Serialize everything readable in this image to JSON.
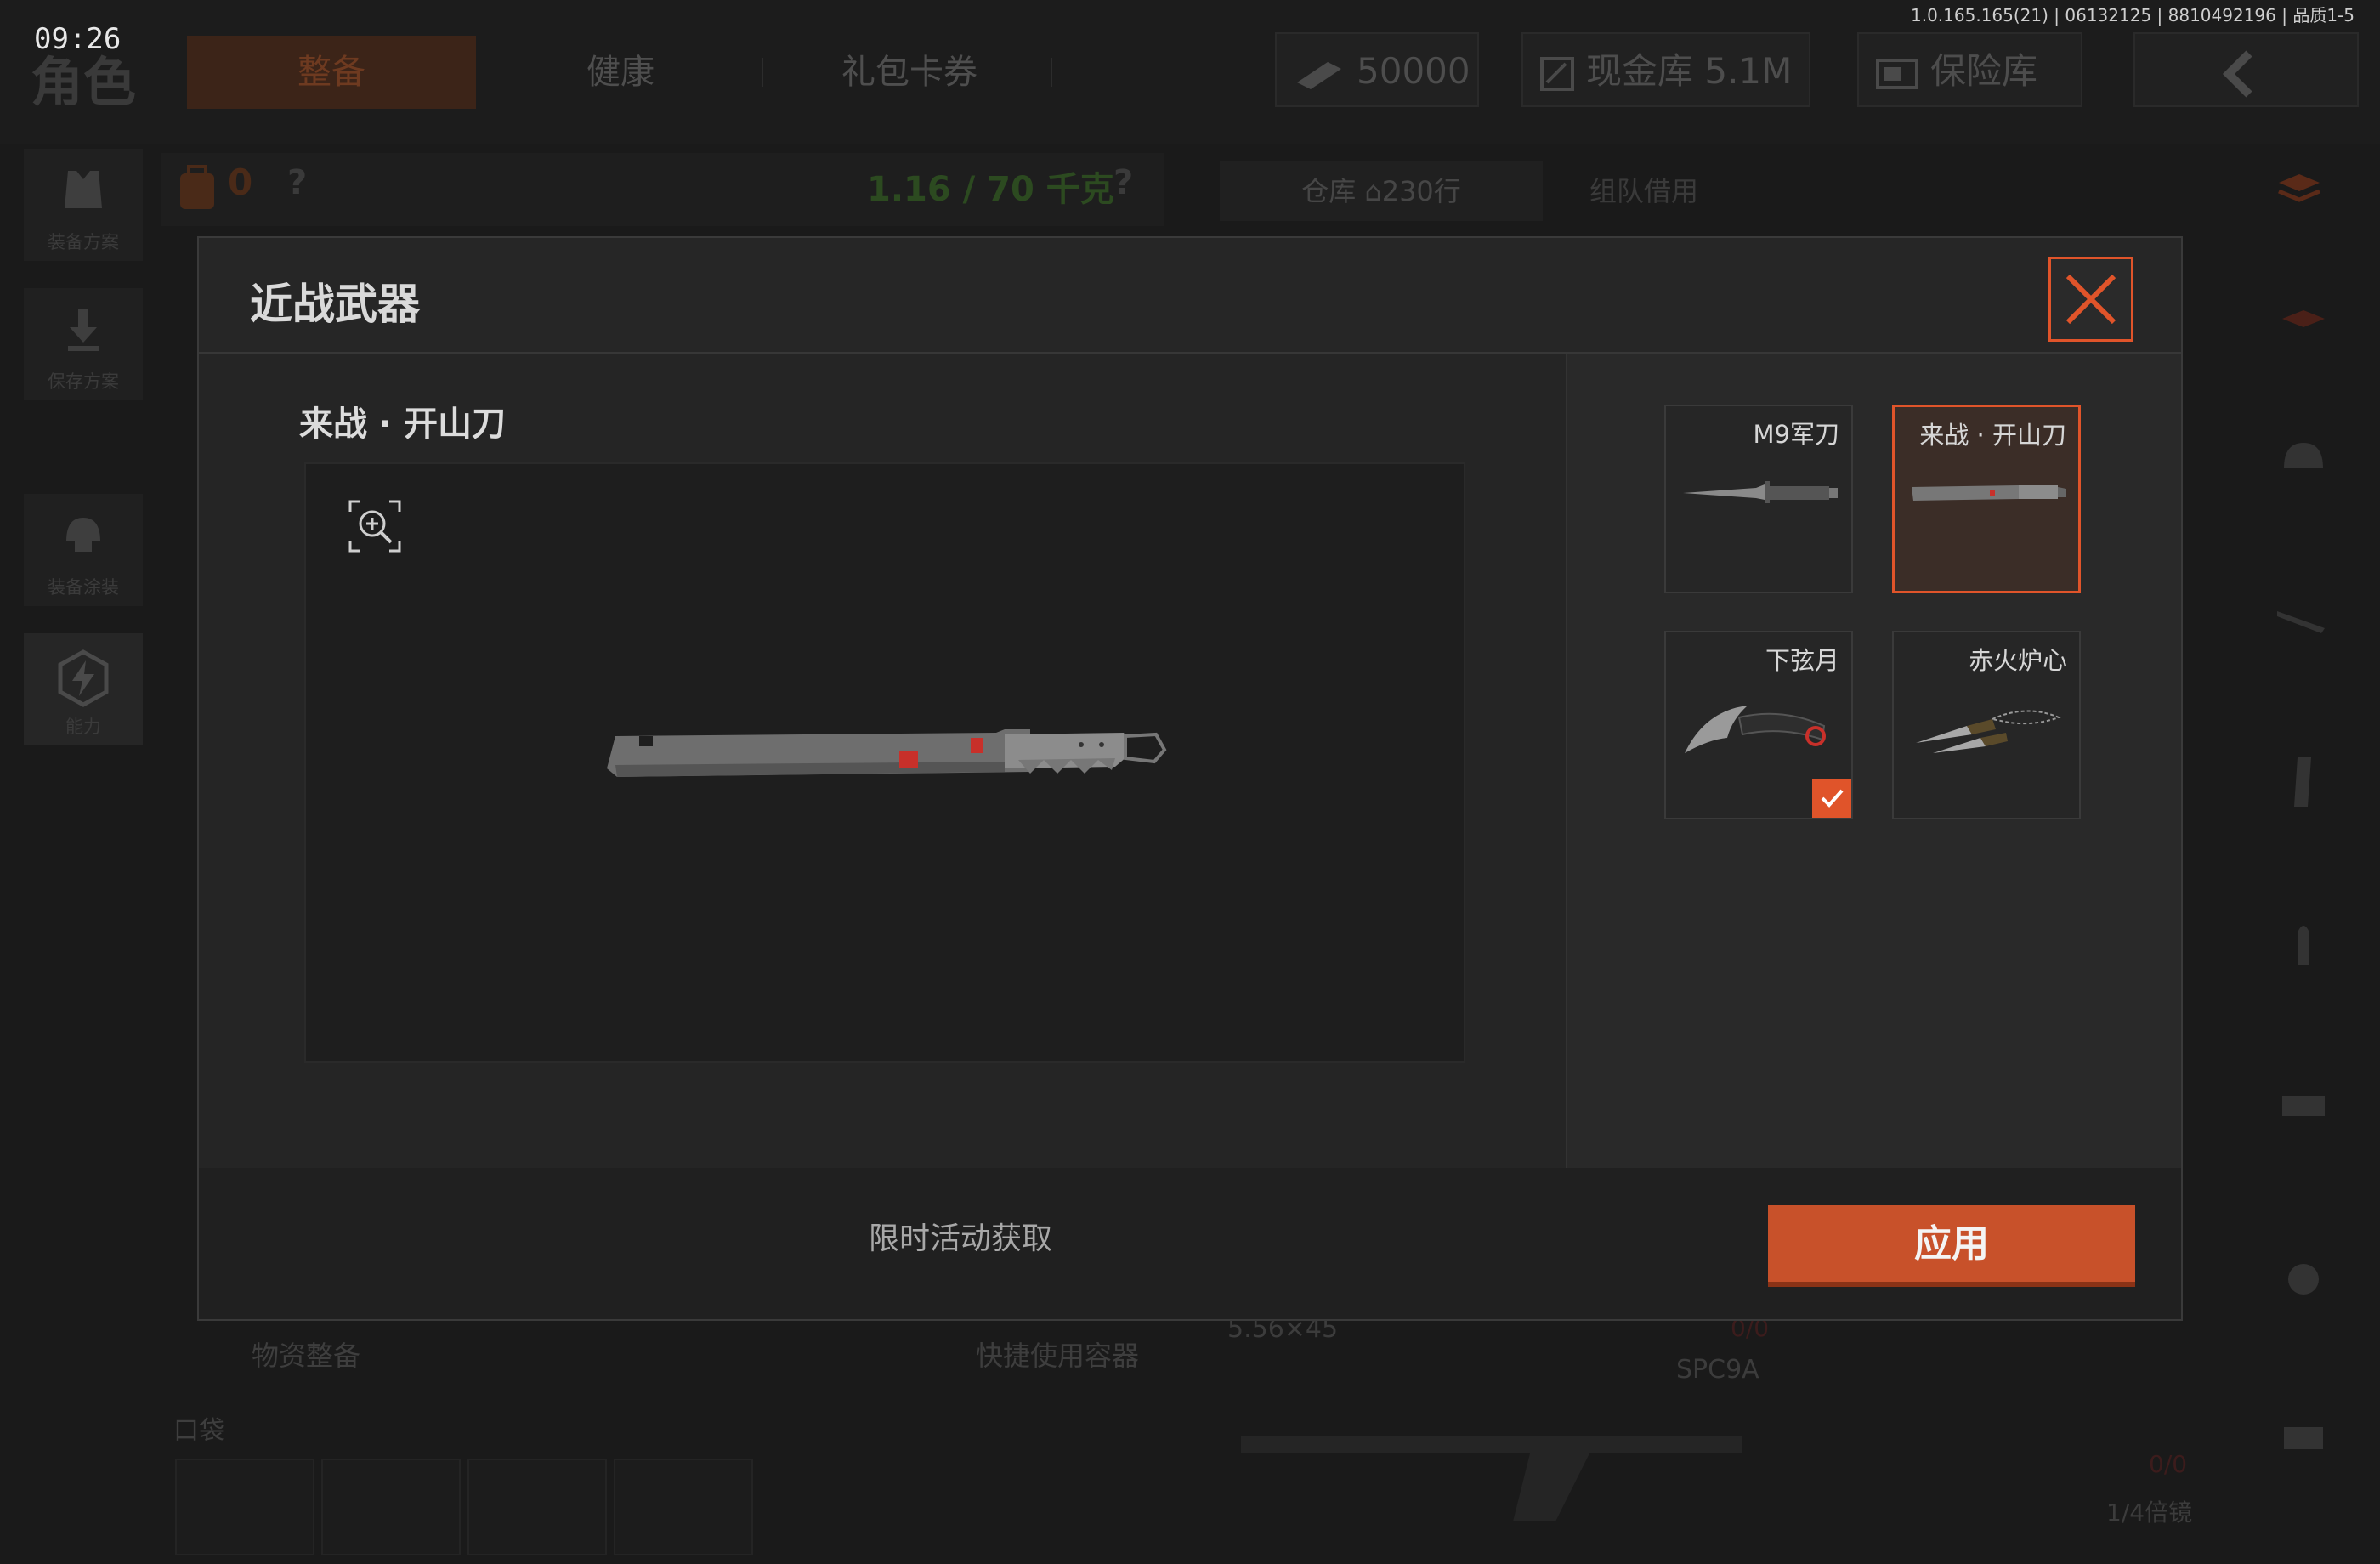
{
  "status": {
    "time": "09:26",
    "build_info": "1.0.165.165(21) | 06132125 | 8810492196 | 品质1-5"
  },
  "page": {
    "title": "角色",
    "tabs": [
      {
        "label": "整备",
        "active": true
      },
      {
        "label": "健康",
        "active": false
      },
      {
        "label": "礼包卡券",
        "active": false
      }
    ]
  },
  "header": {
    "currency": "50000",
    "cash_vault": "现金库 5.1M",
    "safe_box": "保险库"
  },
  "sidebar": {
    "items": [
      {
        "label": "装备方案",
        "icon": "vest-icon"
      },
      {
        "label": "保存方案",
        "icon": "download-icon"
      },
      {
        "label": "装备涂装",
        "icon": "helmet-icon"
      },
      {
        "label": "能力",
        "icon": "ability-bolt-icon"
      }
    ]
  },
  "backpack": {
    "count": "0",
    "weight": "1.16 / 70 千克",
    "help": "?"
  },
  "warehouse": {
    "tab_label": "仓库",
    "rows": "230行",
    "team_borrow": "组队借用",
    "caliber": "5.56×45",
    "ammo": "0/0",
    "weapon": "SPC9A",
    "ammo2": "0/0",
    "scope": "1/4倍镜"
  },
  "loadout": {
    "supplies": "物资整备",
    "quick_container": "快捷使用容器",
    "pocket": "口袋"
  },
  "modal": {
    "title": "近战武器",
    "selected_name": "来战 · 开山刀",
    "options": [
      {
        "name": "M9军刀",
        "selected": false,
        "equipped": false,
        "icon": "bayonet-icon"
      },
      {
        "name": "来战 · 开山刀",
        "selected": true,
        "equipped": false,
        "icon": "machete-icon"
      },
      {
        "name": "下弦月",
        "selected": false,
        "equipped": true,
        "icon": "karambit-icon"
      },
      {
        "name": "赤火炉心",
        "selected": false,
        "equipped": false,
        "icon": "dual-blades-icon"
      }
    ],
    "acquire_text": "限时活动获取",
    "apply_label": "应用",
    "accent": "#e0542a"
  }
}
